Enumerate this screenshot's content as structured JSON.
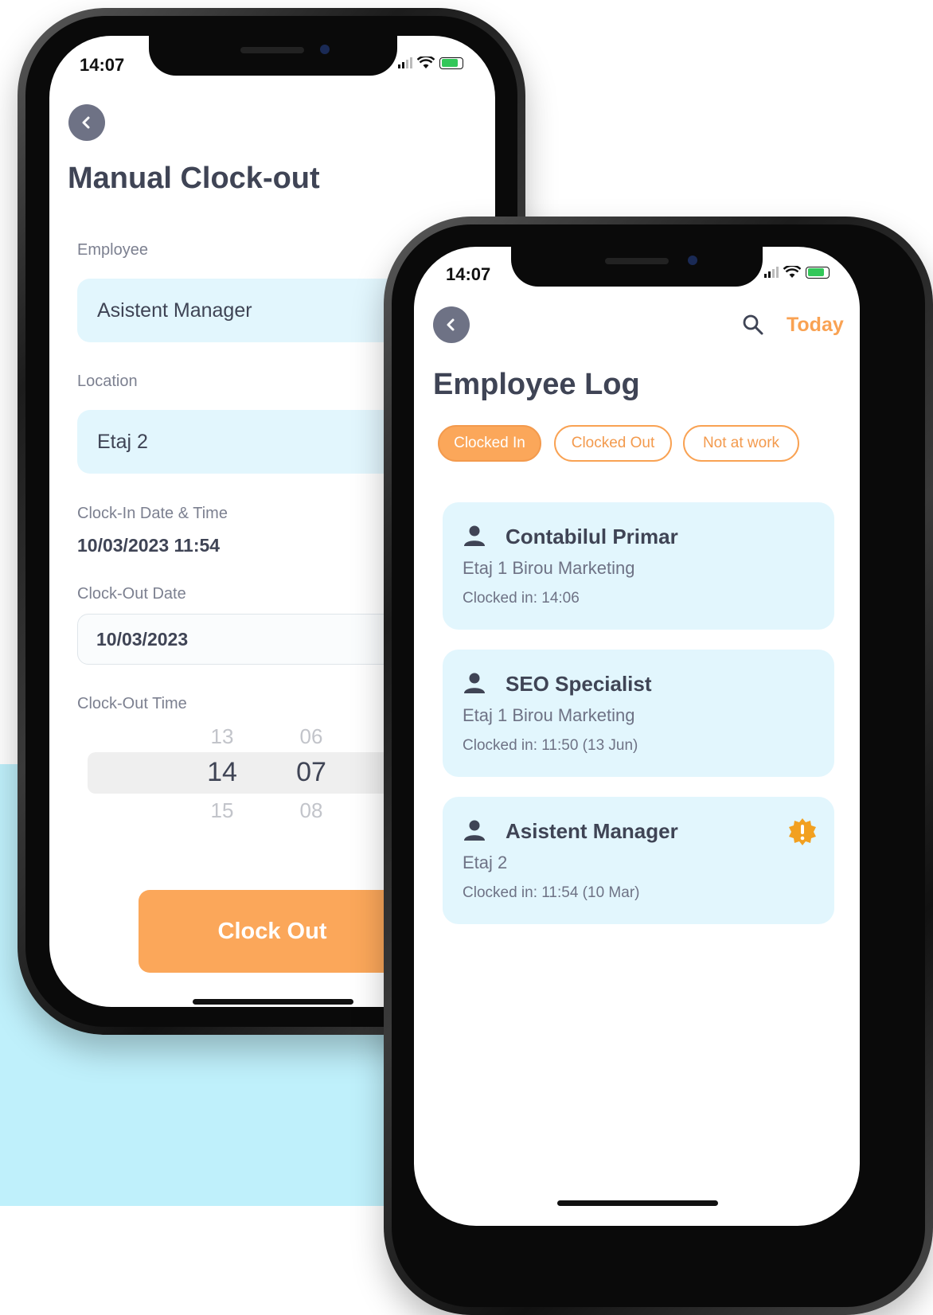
{
  "colors": {
    "accent": "#fba75a",
    "field_bg": "#e2f6fd",
    "text_dark": "#3f4455",
    "back_button": "#6e7285",
    "backdrop": "#bff0fb"
  },
  "clockout_screen": {
    "status_time": "14:07",
    "back_icon": "chevron-left-icon",
    "title": "Manual Clock-out",
    "employee_label": "Employee",
    "employee_value": "Asistent Manager",
    "location_label": "Location",
    "location_value": "Etaj 2",
    "clockin_label": "Clock-In Date & Time",
    "clockin_value": "10/03/2023 11:54",
    "clockout_date_label": "Clock-Out Date",
    "clockout_date_value": "10/03/2023",
    "clockout_time_label": "Clock-Out Time",
    "picker": {
      "hours": [
        "13",
        "14",
        "15"
      ],
      "minutes": [
        "06",
        "07",
        "08"
      ]
    },
    "clock_out_button": "Clock Out"
  },
  "log_screen": {
    "status_time": "14:07",
    "back_icon": "chevron-left-icon",
    "search_icon": "search-icon",
    "today_label": "Today",
    "title": "Employee Log",
    "filters": [
      {
        "label": "Clocked In",
        "active": true
      },
      {
        "label": "Clocked Out",
        "active": false
      },
      {
        "label": "Not at work",
        "active": false
      }
    ],
    "entries": [
      {
        "name": "Contabilul Primar",
        "location": "Etaj 1 Birou Marketing",
        "clocked_in": "Clocked in: 14:06",
        "alert": false
      },
      {
        "name": "SEO Specialist",
        "location": "Etaj 1 Birou Marketing",
        "clocked_in": "Clocked in: 11:50 (13 Jun)",
        "alert": false
      },
      {
        "name": "Asistent Manager",
        "location": "Etaj 2",
        "clocked_in": "Clocked in: 11:54 (10 Mar)",
        "alert": true
      }
    ]
  }
}
